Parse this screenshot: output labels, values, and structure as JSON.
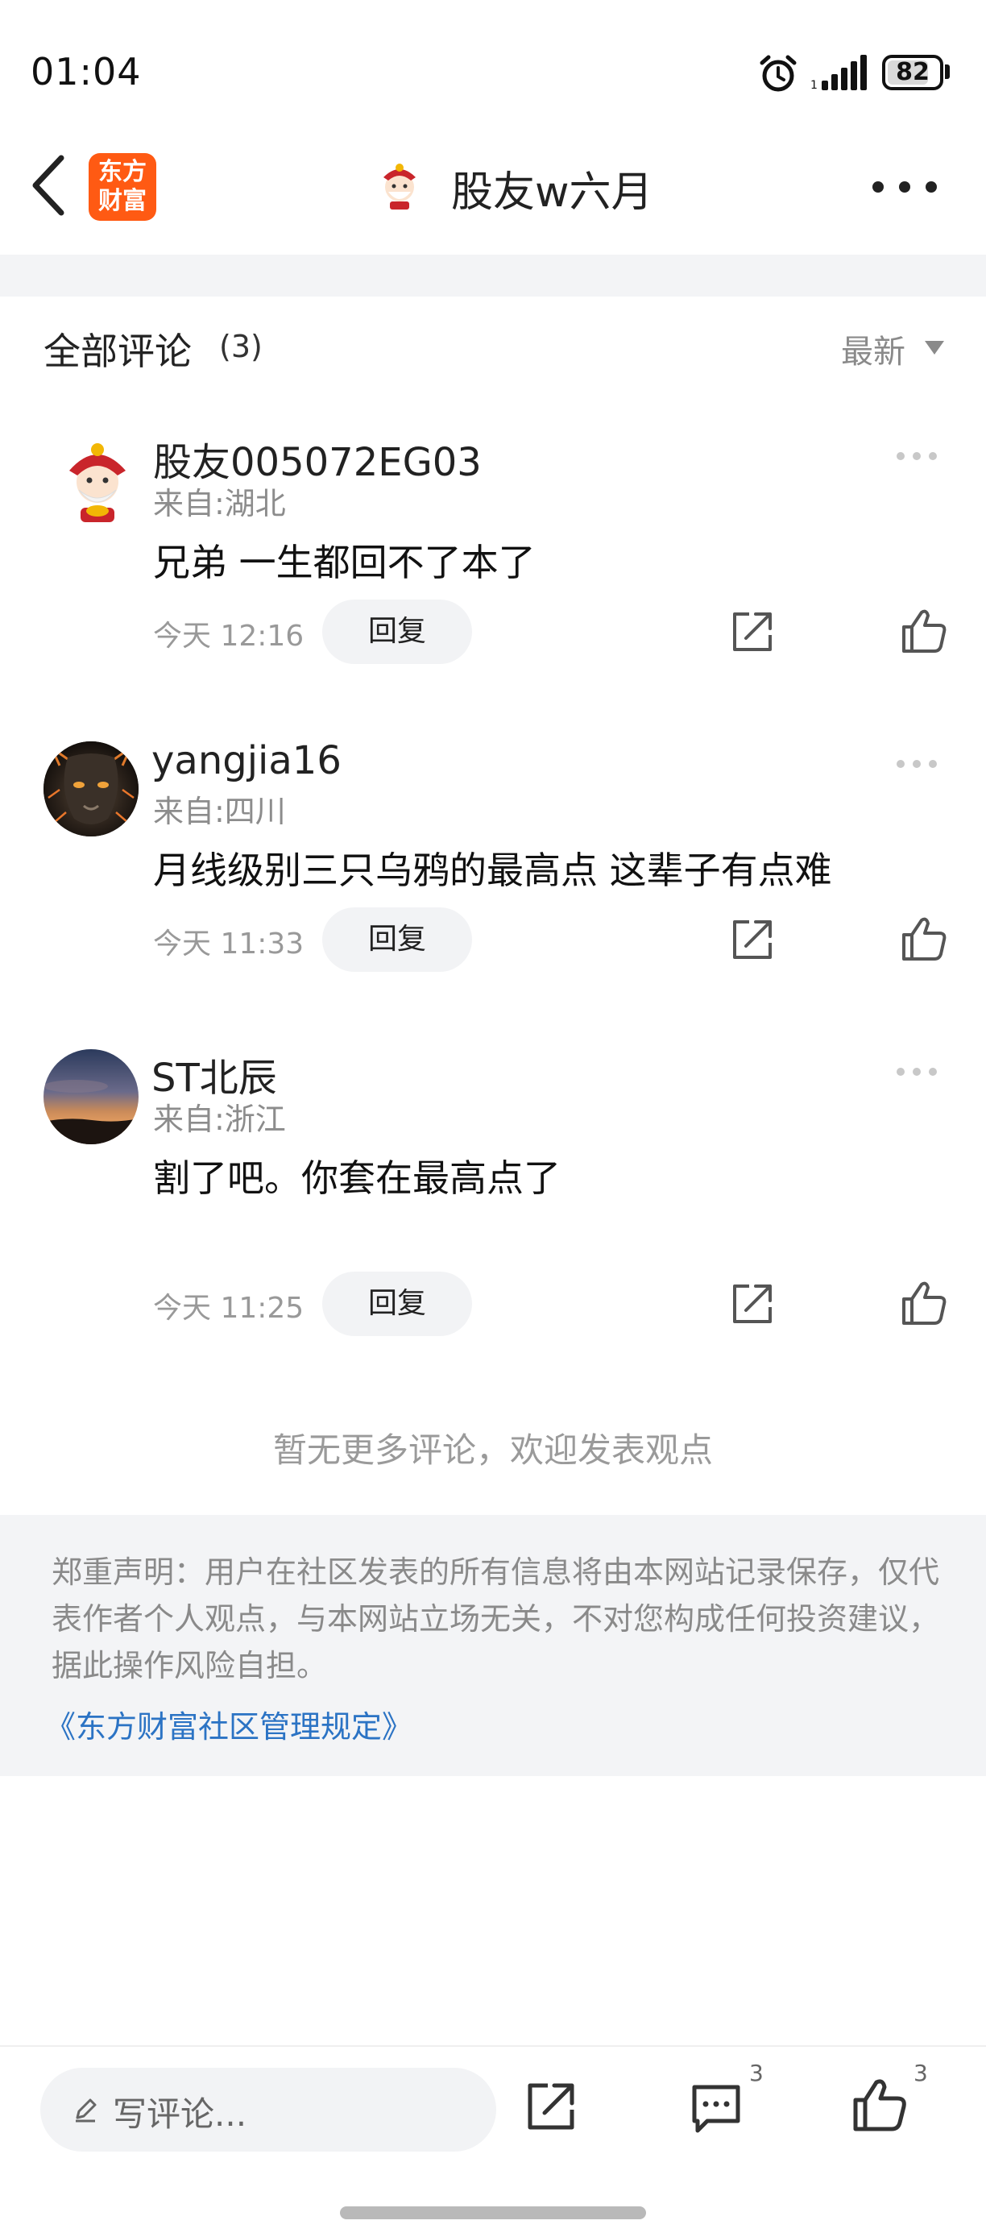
{
  "status_bar": {
    "time": "01:04",
    "battery": "82",
    "battery_level_percent": 82
  },
  "nav": {
    "app_logo_line1": "东方",
    "app_logo_line2": "财富",
    "title": "股友w六月"
  },
  "section": {
    "title": "全部评论",
    "count": "(3)",
    "sort": "最新"
  },
  "comments": [
    {
      "username": "股友005072EG03",
      "location": "来自:湖北",
      "text": "兄弟 一生都回不了本了",
      "time": "今天 12:16",
      "reply": "回复"
    },
    {
      "username": "yangjia16",
      "location": "来自:四川",
      "text": "月线级别三只乌鸦的最高点 这辈子有点难",
      "time": "今天 11:33",
      "reply": "回复"
    },
    {
      "username": "ST北辰",
      "location": "来自:浙江",
      "text": "割了吧。你套在最高点了",
      "time": "今天 11:25",
      "reply": "回复"
    }
  ],
  "footer": {
    "no_more": "暂无更多评论，欢迎发表观点",
    "disclaimer": "郑重声明：用户在社区发表的所有信息将由本网站记录保存，仅代表作者个人观点，与本网站立场无关，不对您构成任何投资建议，据此操作风险自担。",
    "rules_link": "《东方财富社区管理规定》"
  },
  "bottom_bar": {
    "placeholder": "写评论...",
    "comment_count": "3",
    "like_count": "3"
  },
  "colors": {
    "brand": "#ff5a13",
    "link": "#2b73c4",
    "muted": "#8a8a8a",
    "panel": "#f3f4f6"
  }
}
